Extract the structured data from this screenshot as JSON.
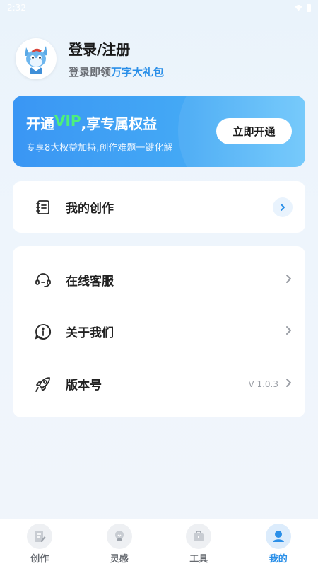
{
  "status_bar": {
    "time": "2:32"
  },
  "profile": {
    "title": "登录/注册",
    "subtitle_prefix": "登录即领",
    "subtitle_highlight": "万字大礼包"
  },
  "vip_card": {
    "title_prefix": "开通",
    "title_vip": "VIP",
    "title_suffix": ",享专属权益",
    "description": "专享8大权益加持,创作难题一键化解",
    "button_label": "立即开通"
  },
  "creation_row": {
    "label": "我的创作",
    "icon": "notebook-icon"
  },
  "menu_items": [
    {
      "label": "在线客服",
      "icon": "headset-icon",
      "value": ""
    },
    {
      "label": "关于我们",
      "icon": "info-icon",
      "value": ""
    },
    {
      "label": "版本号",
      "icon": "rocket-icon",
      "value": "V 1.0.3"
    }
  ],
  "tabs": [
    {
      "label": "创作",
      "icon": "edit-icon",
      "active": false
    },
    {
      "label": "灵感",
      "icon": "lightbulb-icon",
      "active": false
    },
    {
      "label": "工具",
      "icon": "toolbox-icon",
      "active": false
    },
    {
      "label": "我的",
      "icon": "user-icon",
      "active": true
    }
  ],
  "colors": {
    "accent": "#2a8fe8",
    "vip_gradient_start": "#3a96f4",
    "vip_gradient_end": "#6cc6fb",
    "vip_highlight": "#4df07a"
  }
}
